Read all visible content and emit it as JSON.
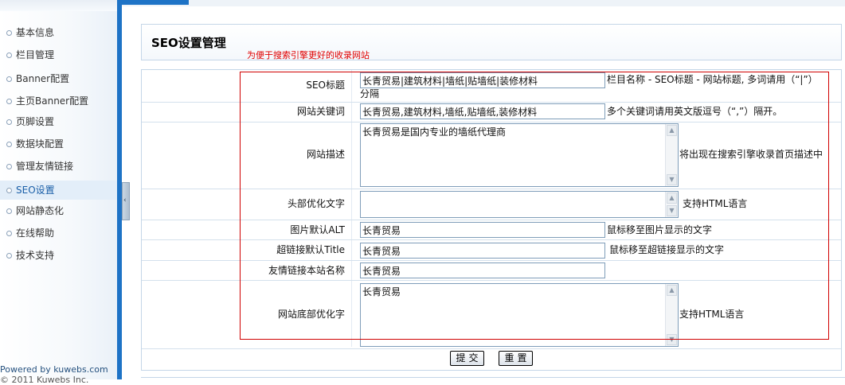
{
  "sidebar": {
    "items": [
      {
        "label": "基本信息"
      },
      {
        "label": "栏目管理"
      },
      {
        "label": "Banner配置"
      },
      {
        "label": "主页Banner配置"
      },
      {
        "label": "页脚设置"
      },
      {
        "label": "数据块配置"
      },
      {
        "label": "管理友情链接"
      },
      {
        "label": "SEO设置"
      },
      {
        "label": "网站静态化"
      },
      {
        "label": "在线帮助"
      },
      {
        "label": "技术支持"
      }
    ],
    "active_item": "SEO设置",
    "powered_by": "Powered by kuwebs.com",
    "copyright": "© 2011  Kuwebs Inc."
  },
  "collapse_handle": {
    "glyph": "‹"
  },
  "page": {
    "title": "SEO设置管理",
    "hint": "为便于搜索引擎更好的收录网站"
  },
  "form": {
    "seo_title": {
      "label": "SEO标题",
      "value": "长青贸易|建筑材料|墙纸|贴墙纸|装修材料",
      "note_line1": "栏目名称  - SEO标题  - 网站标题, 多词请用（“|”）",
      "note_line2": "分隔"
    },
    "keywords": {
      "label": "网站关键词",
      "value": "长青贸易,建筑材料,墙纸,贴墙纸,装修材料",
      "note": "多个关键词请用英文版逗号（“,”）隔开。"
    },
    "description": {
      "label": "网站描述",
      "value": "长青贸易是国内专业的墙纸代理商",
      "note": "将出现在搜索引擎收录首页描述中"
    },
    "header_text": {
      "label": "头部优化文字",
      "value": "",
      "note": "支持HTML语言"
    },
    "img_alt": {
      "label": "图片默认ALT",
      "value": "长青贸易",
      "note": "鼠标移至图片显示的文字"
    },
    "link_title": {
      "label": "超链接默认Title",
      "value": "长青贸易",
      "note": "鼠标移至超链接显示的文字"
    },
    "friend_name": {
      "label": "友情链接本站名称",
      "value": "长青贸易"
    },
    "footer_text": {
      "label": "网站底部优化字",
      "value": "长青贸易",
      "note": "支持HTML语言"
    },
    "submit_label": "提交",
    "reset_label": "重置"
  },
  "colors": {
    "divider": "#1e73c6",
    "hint": "#e00000",
    "highlight_frame": "#d00000"
  },
  "icons": {
    "nav_bullet": "circle-bullet-icon",
    "collapse": "chevron-left-icon",
    "scroll_up": "scroll-up-arrow-icon",
    "scroll_down": "scroll-down-arrow-icon"
  }
}
